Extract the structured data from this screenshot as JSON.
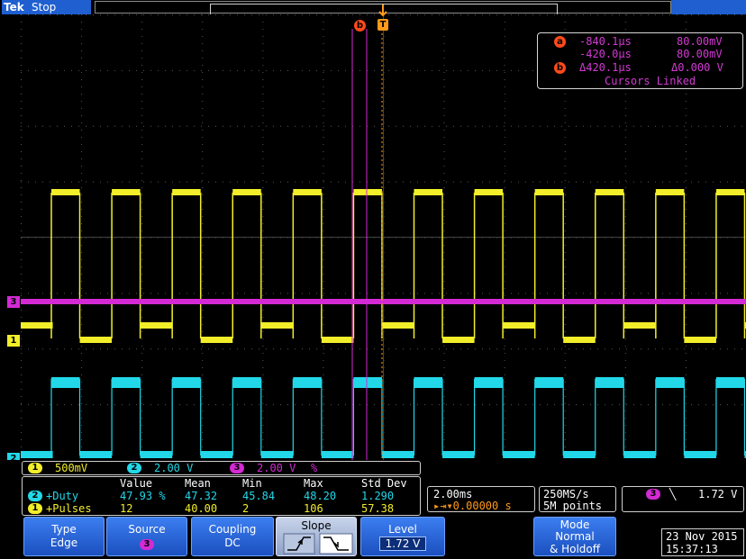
{
  "header": {
    "logo": "Tek",
    "run_state": "Stop"
  },
  "cursors": {
    "a_label": "a",
    "b_label": "b",
    "a_time": "-840.1µs",
    "a_volt": "80.00mV",
    "b_time": "-420.0µs",
    "b_volt": "80.00mV",
    "delta_time": "Δ420.1µs",
    "delta_volt": "Δ0.000 V",
    "linked": "Cursors Linked"
  },
  "markers": {
    "trigger_T": "T",
    "ch3": "3",
    "ch1": "1",
    "ch2": "2"
  },
  "vertical": {
    "ch1_badge": "1",
    "ch1_scale": "500mV",
    "ch2_badge": "2",
    "ch2_scale": "2.00 V",
    "ch3_badge": "3",
    "ch3_scale": "2.00 V",
    "ch3_suffix": "%"
  },
  "measurements": {
    "headers": [
      "Value",
      "Mean",
      "Min",
      "Max",
      "Std Dev"
    ],
    "rows": [
      {
        "badge": "2",
        "name": "+Duty",
        "value": "47.93 %",
        "mean": "47.32",
        "min": "45.84",
        "max": "48.20",
        "std": "1.290"
      },
      {
        "badge": "1",
        "name": "+Pulses",
        "value": "12",
        "mean": "40.00",
        "min": "2",
        "max": "106",
        "std": "57.38"
      }
    ]
  },
  "timebase": {
    "scale": "2.00ms",
    "position": "▸⇥▾0.00000 s"
  },
  "acquisition": {
    "rate": "250MS/s",
    "points": "5M points"
  },
  "trigger": {
    "source_badge": "3",
    "slope_symbol": "╲",
    "level": "1.72 V"
  },
  "menu": {
    "type_title": "Type",
    "type_value": "Edge",
    "source_title": "Source",
    "source_value": "3",
    "coupling_title": "Coupling",
    "coupling_value": "DC",
    "slope_title": "Slope",
    "level_title": "Level",
    "level_value": "1.72 V",
    "mode_title": "Mode",
    "mode_value1": "Normal",
    "mode_value2": "& Holdoff"
  },
  "datetime": {
    "date": "23 Nov 2015",
    "time": "15:37:13"
  },
  "colors": {
    "ch1": "#f2ee2a",
    "ch2": "#22d8e8",
    "ch3": "#d42ad4",
    "cursor": "#d42ad4",
    "cursor_badge": "#ff4a1a",
    "trigger": "#ff9a1a",
    "menu_blue": "#2b64d8"
  },
  "waveform": {
    "ch1_period_divs": 1.0,
    "ch2_period_divs": 1.0,
    "duty_cycle": 0.47,
    "pulse_count": 12
  }
}
